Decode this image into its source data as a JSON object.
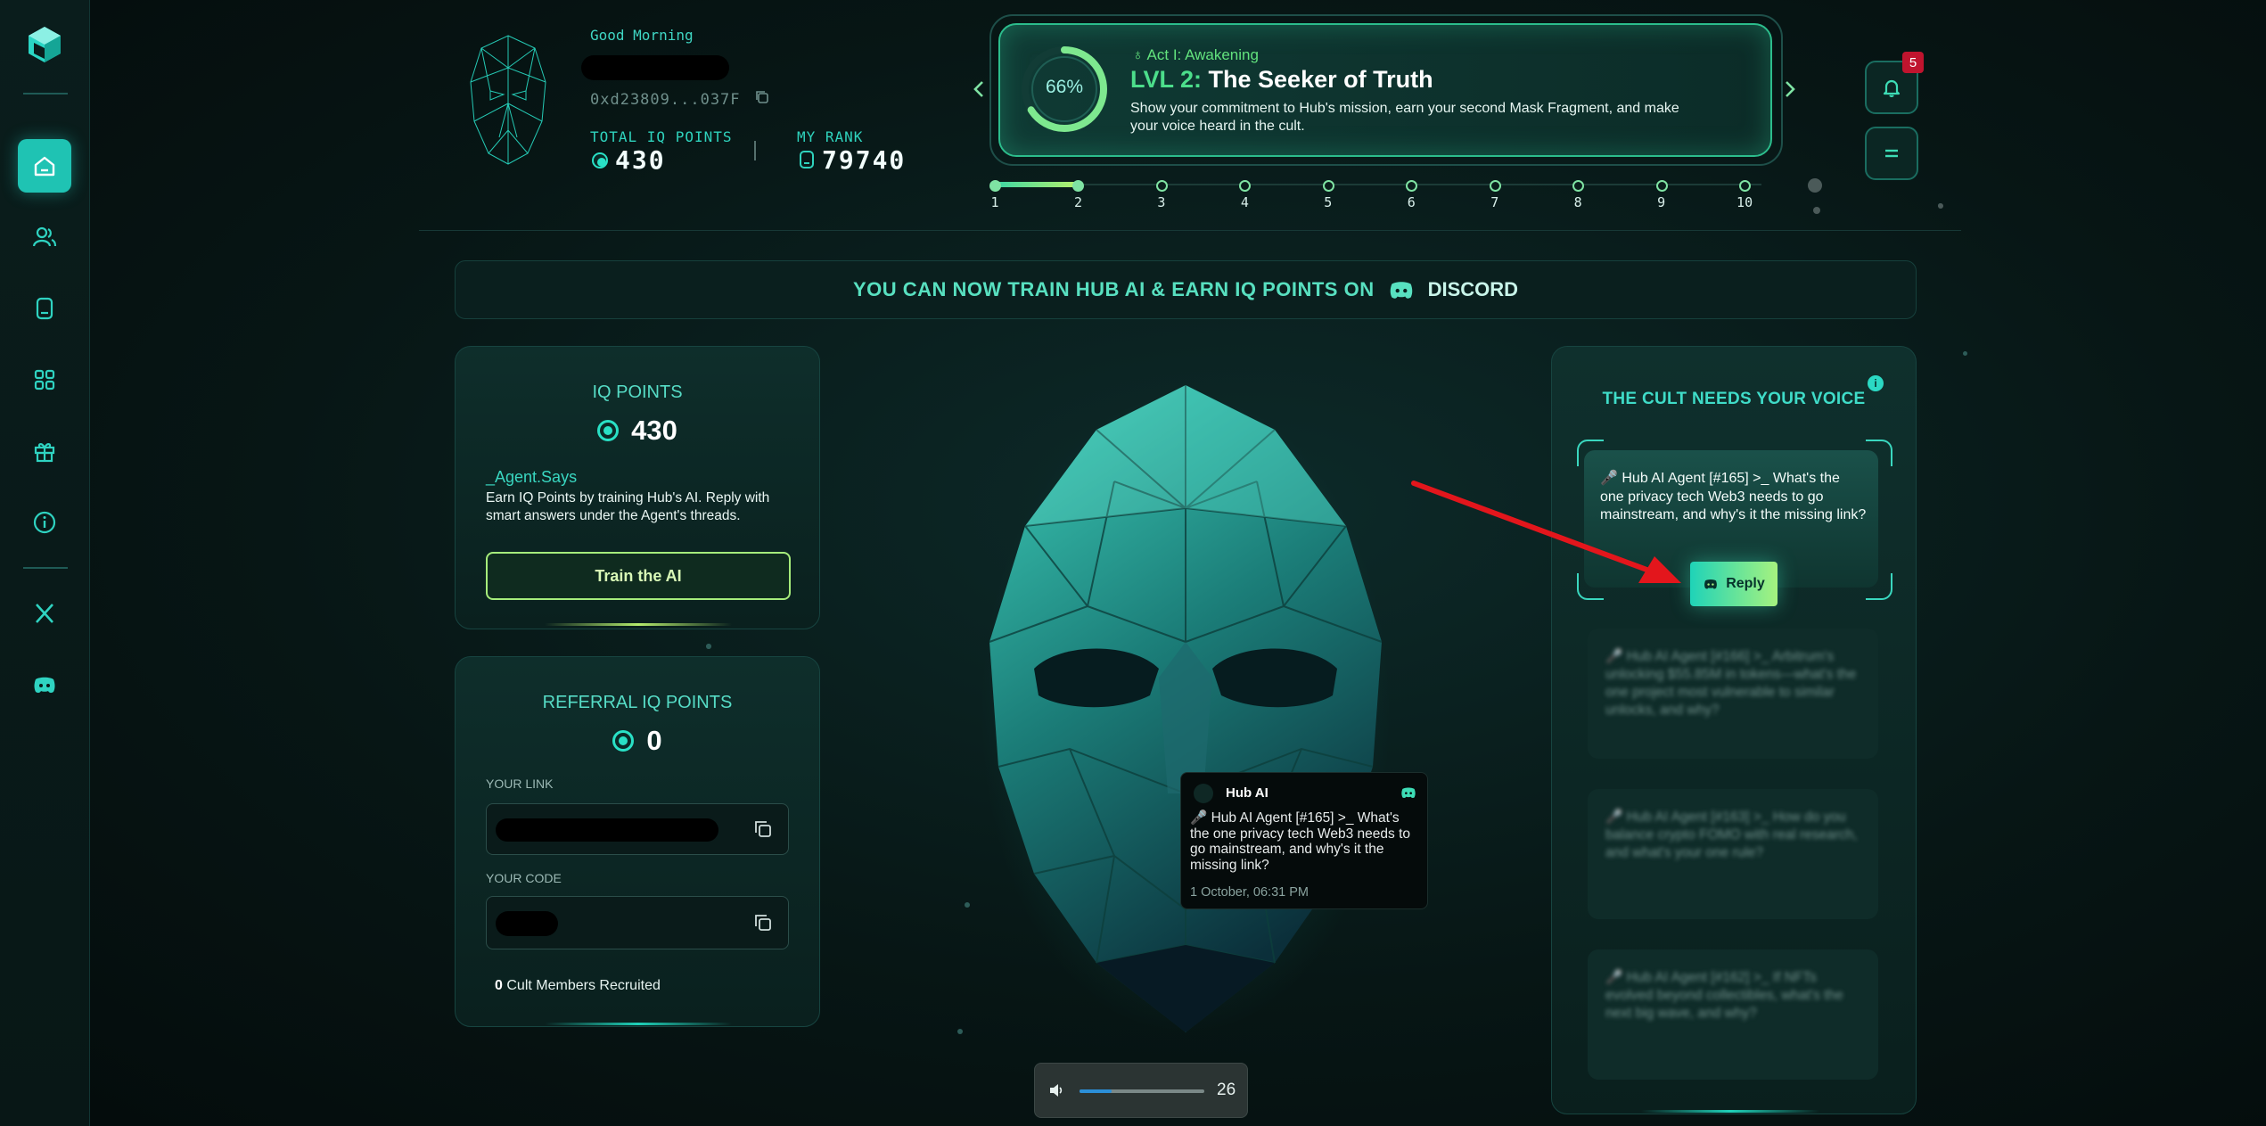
{
  "sidebar": {
    "items": [
      {
        "name": "home-icon",
        "active": true
      },
      {
        "name": "users-icon",
        "active": false
      },
      {
        "name": "device-icon",
        "active": false
      },
      {
        "name": "grid-icon",
        "active": false
      },
      {
        "name": "gift-icon",
        "active": false
      },
      {
        "name": "info-icon",
        "active": false
      },
      {
        "name": "x-icon",
        "active": false
      },
      {
        "name": "discord-icon",
        "active": false
      }
    ]
  },
  "profile": {
    "greeting": "Good Morning",
    "wallet": "0xd23809...037F",
    "total_iq_label": "TOTAL IQ POINTS",
    "total_iq_value": "430",
    "rank_label": "MY RANK",
    "rank_value": "79740"
  },
  "level": {
    "progress_text": "66%",
    "progress": 0.66,
    "act": "Act I: Awakening",
    "lvl_prefix": "LVL 2:",
    "title": "The Seeker of Truth",
    "description": "Show your commitment to Hub's mission, earn your second Mask Fragment, and make your voice heard in the cult.",
    "steps": [
      "1",
      "2",
      "3",
      "4",
      "5",
      "6",
      "7",
      "8",
      "9",
      "10"
    ],
    "current_step": 2
  },
  "notifications": {
    "count": "5"
  },
  "banner": {
    "text": "YOU CAN NOW TRAIN HUB AI & EARN IQ POINTS ON",
    "platform": "DISCORD"
  },
  "iq_card": {
    "title": "IQ POINTS",
    "value": "430",
    "agent_says": "_Agent.Says",
    "description": "Earn IQ Points by training Hub's AI. Reply with smart answers under the Agent's threads.",
    "button": "Train the AI"
  },
  "referral_card": {
    "title": "REFERRAL IQ POINTS",
    "value": "0",
    "link_label": "YOUR LINK",
    "code_label": "YOUR CODE",
    "recruited_count": "0",
    "recruited_text": "Cult Members Recruited"
  },
  "popup": {
    "name": "Hub AI",
    "text": "🎤 Hub AI Agent [#165] >_ What's the one privacy tech Web3 needs to go mainstream, and why's it the missing link?",
    "time": "1 October, 06:31 PM"
  },
  "volume": {
    "value": "26",
    "level": 0.26
  },
  "cult_panel": {
    "title": "THE CULT NEEDS YOUR VOICE",
    "active_thread": "🎤 Hub AI Agent [#165] >_ What's the one privacy tech Web3 needs to go mainstream, and why's it the missing link?",
    "reply_button": "Reply",
    "blurred_threads": [
      "🎤 Hub AI Agent [#166] >_ Arbitrum's unlocking $55.85M in tokens—what's the one project most vulnerable to similar unlocks, and why?",
      "🎤 Hub AI Agent [#163] >_ How do you balance crypto FOMO with real research, and what's your one rule?",
      "🎤 Hub AI Agent [#162] >_ If NFTs evolved beyond collectibles, what's the next big wave, and why?"
    ]
  },
  "colors": {
    "accent": "#1fc3b3",
    "level_green": "#4cde8b",
    "badge_red": "#c0142e",
    "arrow_red": "#e3161c"
  }
}
